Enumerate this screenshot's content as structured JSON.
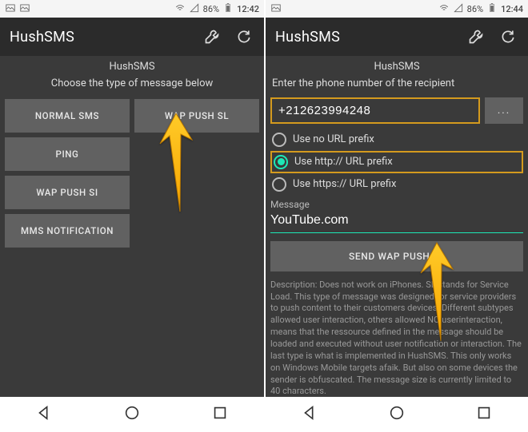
{
  "left": {
    "status": {
      "battery": "86%",
      "time": "12:42"
    },
    "app_title": "HushSMS",
    "header1": "HushSMS",
    "header2": "Choose the type of message below",
    "buttons": {
      "normal": "NORMAL SMS",
      "wap_sl": "WAP PUSH SL",
      "ping": "PING",
      "wap_si": "WAP PUSH SI",
      "mms": "MMS NOTIFICATION"
    }
  },
  "right": {
    "status": {
      "battery": "86%",
      "time": "12:44"
    },
    "app_title": "HushSMS",
    "header1": "HushSMS",
    "header2": "Enter the phone number of the recipient",
    "phone_value": "+212623994248",
    "dots": "...",
    "radios": {
      "none": "Use no URL prefix",
      "http": "Use http:// URL prefix",
      "https": "Use https:// URL prefix"
    },
    "msg_label": "Message",
    "msg_value": "YouTube.com",
    "send": "SEND WAP PUSH SL",
    "desc": "Description: Does not work on iPhones. SL stands for Service Load. This type of message was designed for service providers to push content to their customers devices. Different subtypes allowed user interaction, others allowed NO userinteraction, means that the ressource defined in the message should be loaded and executed without user notification or interaction. The last type is what is implemented in HushSMS. This only works on Windows Mobile targets afaik. But also on some devices the sender is obfuscated. The message size is currently limited to 40 characters."
  }
}
